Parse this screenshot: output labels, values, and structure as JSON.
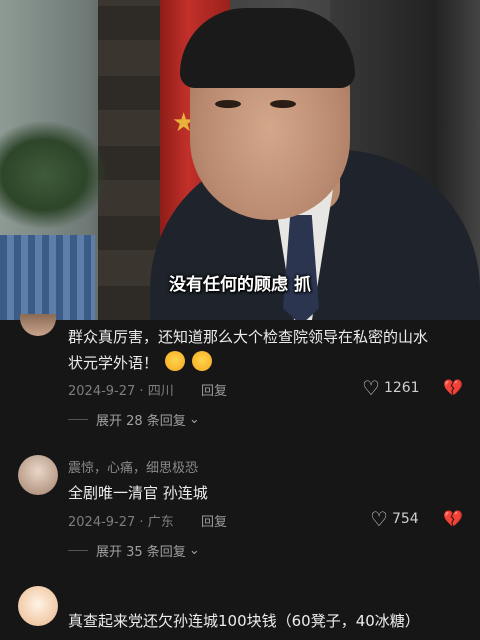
{
  "video": {
    "subtitle": "没有任何的顾虑  抓"
  },
  "comments": [
    {
      "body_line1": "群众真厉害，还知道那么大个检查院领导在私密的山水",
      "body_line2": "状元学外语！",
      "date": "2024-9-27",
      "region": "四川",
      "reply_label": "回复",
      "likes": "1261",
      "expand_label": "展开 28 条回复"
    },
    {
      "username": "震惊，心痛，细思极恐",
      "body_line1": "全剧唯一清官 孙连城",
      "date": "2024-9-27",
      "region": "广东",
      "reply_label": "回复",
      "likes": "754",
      "expand_label": "展开 35 条回复"
    },
    {
      "body_line1": "真查起来党还欠孙连城100块钱（60凳子，40冰糖）"
    }
  ],
  "icons": {
    "like": "heart-outline-icon",
    "dislike": "broken-heart-icon",
    "expand": "chevron-down-icon",
    "emoji": "laughing-crying-emoji-icon"
  },
  "colors": {
    "background": "#161616",
    "text": "#ececec",
    "meta": "#7d7d7d"
  }
}
